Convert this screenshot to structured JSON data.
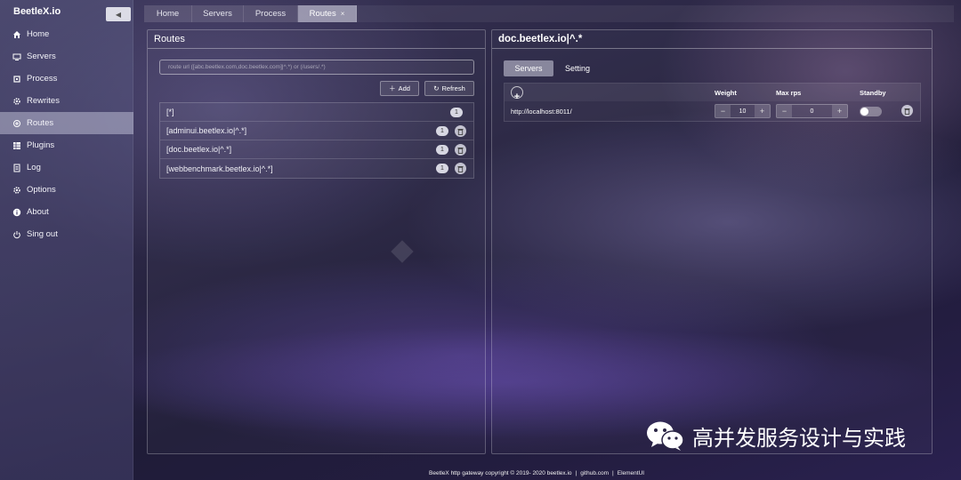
{
  "app": {
    "brand": "BeetleX.io",
    "collapse_icon": "caret-left-icon"
  },
  "sidebar": {
    "items": [
      {
        "label": "Home",
        "icon": "home-icon",
        "active": false
      },
      {
        "label": "Servers",
        "icon": "monitor-icon",
        "active": false
      },
      {
        "label": "Process",
        "icon": "cpu-icon",
        "active": false
      },
      {
        "label": "Rewrites",
        "icon": "gear-icon",
        "active": false
      },
      {
        "label": "Routes",
        "icon": "route-icon",
        "active": true
      },
      {
        "label": "Plugins",
        "icon": "grid-icon",
        "active": false
      },
      {
        "label": "Log",
        "icon": "document-icon",
        "active": false
      },
      {
        "label": "Options",
        "icon": "gear-icon",
        "active": false
      },
      {
        "label": "About",
        "icon": "info-icon",
        "active": false
      },
      {
        "label": "Sing out",
        "icon": "power-icon",
        "active": false
      }
    ]
  },
  "tabs": [
    {
      "label": "Home"
    },
    {
      "label": "Servers"
    },
    {
      "label": "Process"
    },
    {
      "label": "Routes",
      "close": "×",
      "active": true
    }
  ],
  "routes_panel": {
    "title": "Routes",
    "input_placeholder": "route url ([abc.beetlex.com,doc.beetlex.com]|^.*) or (/users/.*)",
    "add_label": "Add",
    "refresh_label": "Refresh",
    "routes": [
      {
        "name": "[*]",
        "count": "1",
        "deletable": false
      },
      {
        "name": "[adminui.beetlex.io|^.*]",
        "count": "1",
        "deletable": true
      },
      {
        "name": "[doc.beetlex.io|^.*]",
        "count": "1",
        "deletable": true
      },
      {
        "name": "[webbenchmark.beetlex.io|^.*]",
        "count": "1",
        "deletable": true
      }
    ]
  },
  "detail_panel": {
    "title": "doc.beetlex.io|^.*",
    "tabs": [
      {
        "label": "Servers",
        "active": true
      },
      {
        "label": "Setting",
        "active": false
      }
    ],
    "columns": {
      "weight": "Weight",
      "max_rps": "Max rps",
      "standby": "Standby"
    },
    "servers": [
      {
        "url": "http://localhost:8011/",
        "weight": "10",
        "max_rps": "0",
        "standby": false
      }
    ],
    "minus": "−",
    "plus": "+"
  },
  "watermark": {
    "text": "高并发服务设计与实践"
  },
  "footer": {
    "copyright": "BeetleX http gateway copyright © 2019- 2020 beetlex.io",
    "sep": "|",
    "github": "github.com",
    "elementui": "ElementUI"
  }
}
